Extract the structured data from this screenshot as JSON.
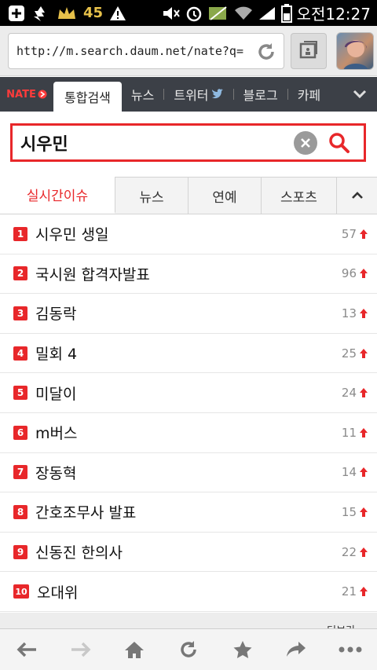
{
  "status_bar": {
    "battery_level": "45",
    "time": "오전12:27",
    "icons": [
      "plus-icon",
      "recycle-icon",
      "crown-icon",
      "warning-icon",
      "mute-icon",
      "alarm-icon",
      "no-signal-icon",
      "wifi-icon",
      "signal-icon",
      "battery-icon"
    ]
  },
  "browser": {
    "url": "http://m.search.daum.net/nate?q=..."
  },
  "nav": {
    "logo": "NATE",
    "tabs": [
      {
        "label": "통합검색"
      },
      {
        "label": "뉴스"
      },
      {
        "label": "트위터"
      },
      {
        "label": "블로그"
      },
      {
        "label": "카페"
      }
    ]
  },
  "search": {
    "query": "시우민"
  },
  "categories": [
    {
      "label": "실시간이슈"
    },
    {
      "label": "뉴스"
    },
    {
      "label": "연예"
    },
    {
      "label": "스포츠"
    }
  ],
  "ranking": [
    {
      "rank": "1",
      "text": "시우민 생일",
      "count": "57"
    },
    {
      "rank": "2",
      "text": "국시원 합격자발표",
      "count": "96"
    },
    {
      "rank": "3",
      "text": "김동락",
      "count": "13"
    },
    {
      "rank": "4",
      "text": "밀회 4",
      "count": "25"
    },
    {
      "rank": "5",
      "text": "미달이",
      "count": "24"
    },
    {
      "rank": "6",
      "text": "m버스",
      "count": "11"
    },
    {
      "rank": "7",
      "text": "장동혁",
      "count": "14"
    },
    {
      "rank": "8",
      "text": "간호조무사 발표",
      "count": "15"
    },
    {
      "rank": "9",
      "text": "신동진 한의사",
      "count": "22"
    },
    {
      "rank": "10",
      "text": "오대위",
      "count": "21"
    }
  ],
  "more_label": "더보기",
  "colors": {
    "accent": "#e8272a",
    "nav_bg": "#3c4047"
  }
}
